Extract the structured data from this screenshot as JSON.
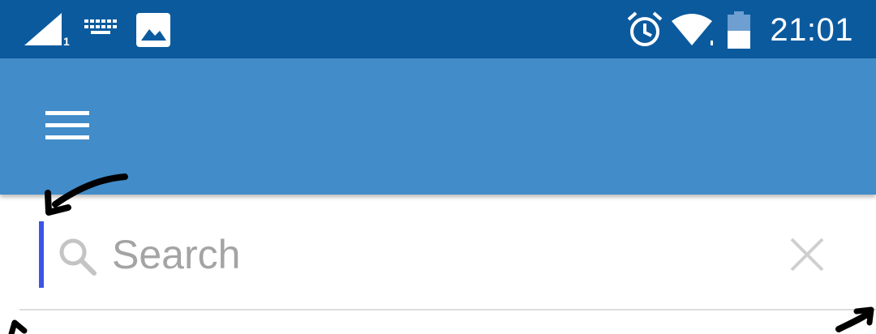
{
  "status_bar": {
    "time": "21:01",
    "sim_slot": "1",
    "icons": [
      "signal-icon",
      "keyboard-icon",
      "image-notification-icon",
      "alarm-icon",
      "wifi-icon",
      "battery-icon"
    ]
  },
  "app_bar": {
    "menu_icon": "hamburger-menu-icon"
  },
  "search": {
    "placeholder": "Search",
    "value": "",
    "search_icon": "search-icon",
    "clear_icon": "close-icon"
  },
  "colors": {
    "status_bar": "#0b5a9e",
    "app_bar": "#418cc9",
    "focus_indicator": "#3c55e6",
    "placeholder": "#a4a4a4",
    "divider": "#dcdcdc",
    "annotation_ink": "#000000"
  }
}
